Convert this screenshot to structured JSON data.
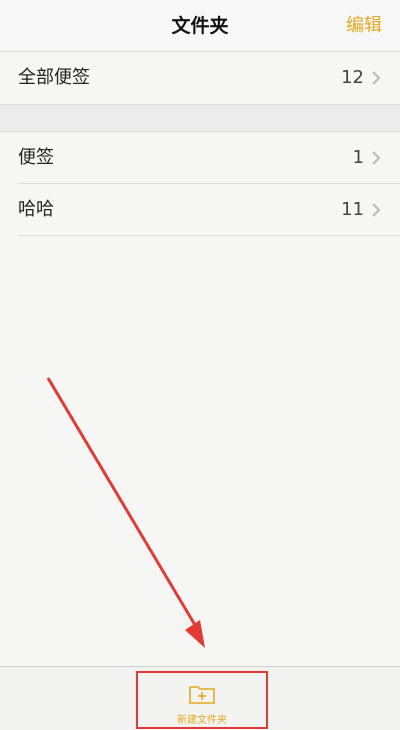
{
  "navbar": {
    "title": "文件夹",
    "edit_label": "编辑"
  },
  "folders": [
    {
      "label": "全部便签",
      "count": "12"
    },
    {
      "label": "便签",
      "count": "1"
    },
    {
      "label": "哈哈",
      "count": "11"
    }
  ],
  "toolbar": {
    "new_folder_label": "新建文件夹",
    "new_folder_icon": "folder-plus-icon"
  },
  "colors": {
    "accent": "#e6a91f",
    "annotation": "#e53935"
  }
}
